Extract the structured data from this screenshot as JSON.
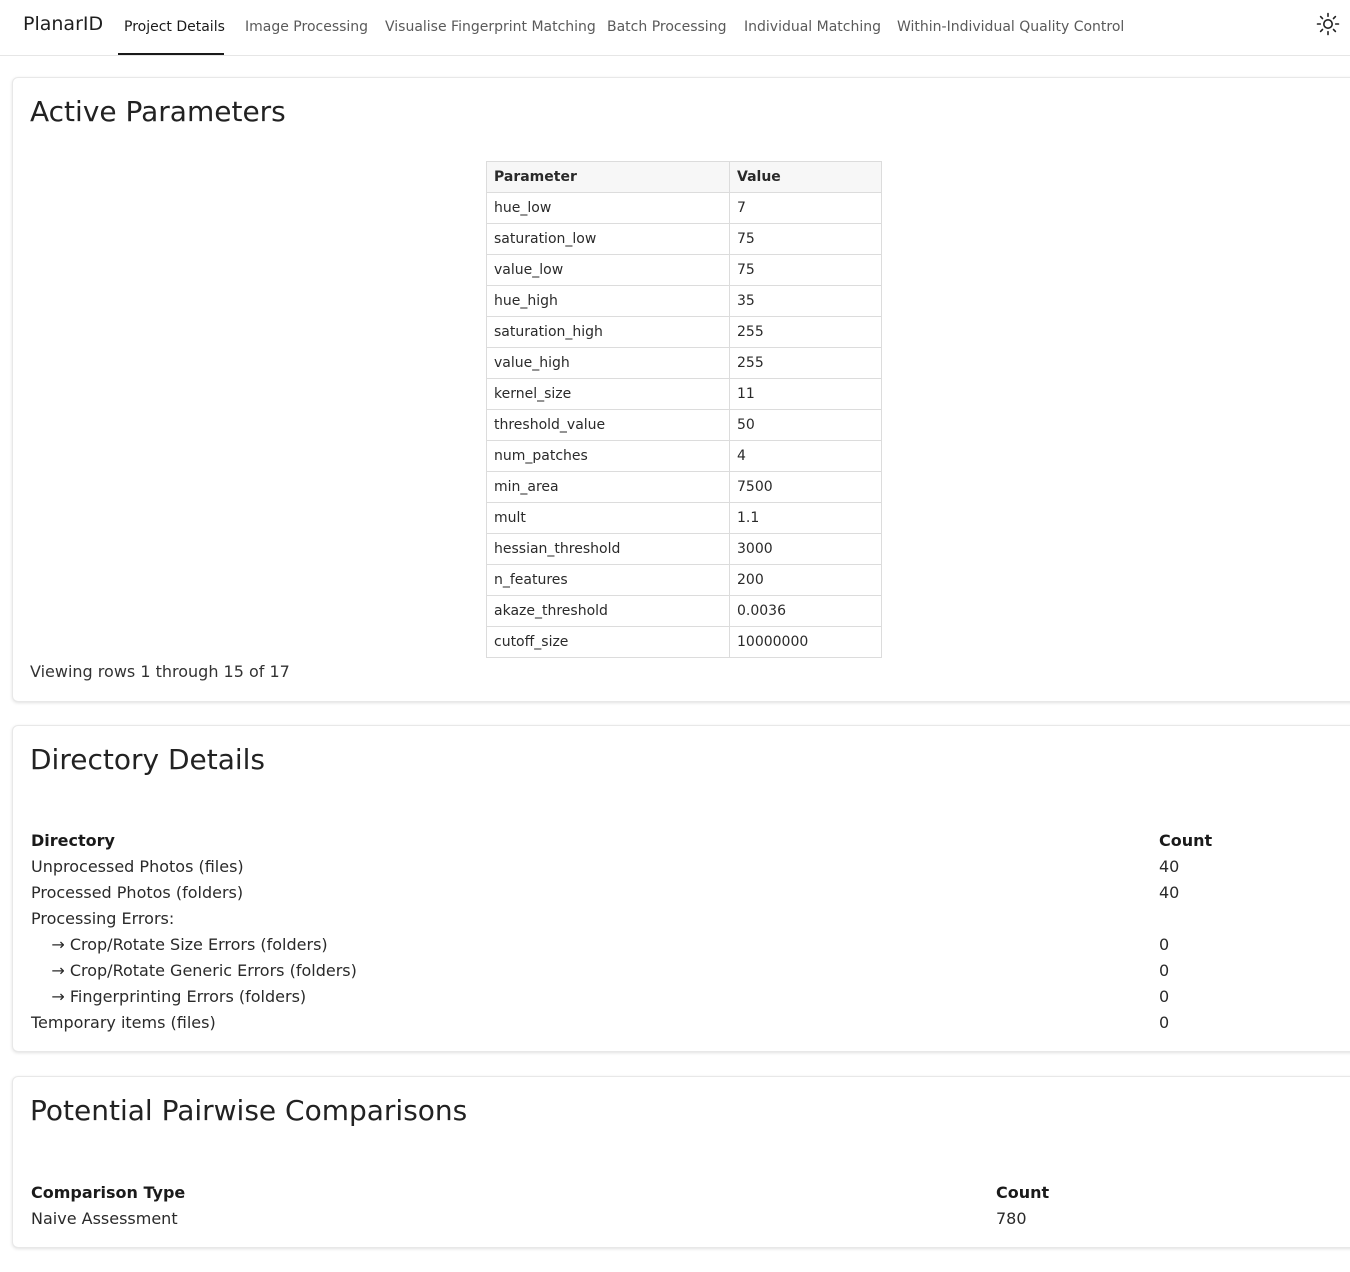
{
  "brand": "PlanarID",
  "nav": {
    "tabs": [
      {
        "label": "Project Details",
        "active": true
      },
      {
        "label": "Image Processing"
      },
      {
        "label": "Visualise Fingerprint Matching"
      },
      {
        "label": "Batch Processing"
      },
      {
        "label": "Individual Matching"
      },
      {
        "label": "Within-Individual Quality Control"
      }
    ],
    "theme_icon": "sun-icon"
  },
  "active_parameters": {
    "title": "Active Parameters",
    "headers": [
      "Parameter",
      "Value"
    ],
    "rows": [
      [
        "hue_low",
        "7"
      ],
      [
        "saturation_low",
        "75"
      ],
      [
        "value_low",
        "75"
      ],
      [
        "hue_high",
        "35"
      ],
      [
        "saturation_high",
        "255"
      ],
      [
        "value_high",
        "255"
      ],
      [
        "kernel_size",
        "11"
      ],
      [
        "threshold_value",
        "50"
      ],
      [
        "num_patches",
        "4"
      ],
      [
        "min_area",
        "7500"
      ],
      [
        "mult",
        "1.1"
      ],
      [
        "hessian_threshold",
        "3000"
      ],
      [
        "n_features",
        "200"
      ],
      [
        "akaze_threshold",
        "0.0036"
      ],
      [
        "cutoff_size",
        "10000000"
      ]
    ],
    "viewing": "Viewing rows 1 through 15 of 17"
  },
  "directory_details": {
    "title": "Directory Details",
    "headers": [
      "Directory",
      "Count"
    ],
    "rows": [
      [
        "Unprocessed Photos (files)",
        "40"
      ],
      [
        "Processed Photos (folders)",
        "40"
      ],
      [
        "Processing Errors:",
        ""
      ],
      [
        "    → Crop/Rotate Size Errors (folders)",
        "0"
      ],
      [
        "    → Crop/Rotate Generic Errors (folders)",
        "0"
      ],
      [
        "    → Fingerprinting Errors (folders)",
        "0"
      ],
      [
        "Temporary items (files)",
        "0"
      ]
    ]
  },
  "pairwise": {
    "title": "Potential Pairwise Comparisons",
    "headers": [
      "Comparison Type",
      "Count"
    ],
    "rows": [
      [
        "Naive Assessment",
        "780"
      ]
    ]
  }
}
